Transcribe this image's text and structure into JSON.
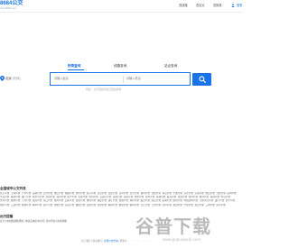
{
  "header": {
    "logo_text": "8684公交",
    "logo_sub": "www.8684.com",
    "nav": [
      {
        "label": "查线路"
      },
      {
        "label": "查站点"
      },
      {
        "label": "查换乘"
      }
    ],
    "login_label": "登录"
  },
  "tabs": [
    {
      "label": "换乘查询",
      "active": true
    },
    {
      "label": "线路查询",
      "active": false
    },
    {
      "label": "站点查询",
      "active": false
    }
  ],
  "search": {
    "city": "北京",
    "city_switch": "[切换]",
    "from_placeholder": "请输入起点",
    "to_placeholder": "请输入终点",
    "hint": "例如：北京南站到北京西站换乘"
  },
  "cities_section": {
    "title": "全国城市公交列表",
    "rows": [
      [
        "北京公交",
        "上海公交",
        "广州公交",
        "深圳公交",
        "天津公交",
        "重庆公交",
        "成都公交",
        "杭州公交",
        "南京公交",
        "武汉公交",
        "西安公交",
        "苏州公交",
        "长沙公交",
        "郑州公交",
        "沈阳公交",
        "青岛公交",
        "宁波公交",
        "东莞公交",
        "无锡公交",
        "佛山公交",
        "合肥公交",
        "昆明公交"
      ],
      [
        "大连公交",
        "福州公交",
        "厦门公交",
        "哈尔滨公交",
        "济南公交",
        "温州公交",
        "南宁公交",
        "长春公交",
        "泉州公交",
        "石家庄公交",
        "贵阳公交",
        "南昌公交",
        "金华公交",
        "常州公交",
        "南通公交",
        "嘉兴公交",
        "太原公交",
        "徐州公交",
        "惠州公交",
        "珠海公交",
        "中山公交"
      ],
      [
        "台州公交",
        "烟台公交",
        "兰州公交",
        "绍兴公交",
        "海口公交",
        "扬州公交",
        "汕头公交",
        "洛阳公交",
        "潍坊公交",
        "保定公交",
        "镇江公交",
        "盐城公交",
        "湖州公交",
        "临沂公交",
        "唐山公交",
        "芜湖公交",
        "廊坊公交",
        "呼和浩特公交",
        "乌鲁木齐公交",
        "银川公交",
        "西宁公交"
      ],
      [
        "拉萨公交",
        "三亚公交",
        "桂林公交",
        "柳州公交",
        "遵义公交",
        "绵阳公交",
        "宜昌公交",
        "襄阳公交",
        "岳阳公交",
        "常德公交",
        "株洲公交",
        "衡阳公交",
        "赣州公交",
        "九江公交",
        "上饶公交",
        "漳州公交",
        "莆田公交",
        "宁德公交",
        "龙岩公交",
        "三明公交",
        "南平公交"
      ]
    ]
  },
  "tips_section": {
    "title": "出行提醒",
    "text": "北京公交线路调整通知 | 地铁首末班车时间 | 票价查询 | 换乘攻略"
  },
  "footer": {
    "prefix": "关于我们 | 联系我们 | ",
    "link": "免费公交查询",
    "suffix": " | 帮助中心 | 合作推广 | 网站地图"
  },
  "watermark": {
    "text": "谷普下载",
    "url": "www.gupuxiazai.com"
  },
  "colors": {
    "accent": "#1a73e8",
    "text": "#333333",
    "muted": "#999999"
  }
}
